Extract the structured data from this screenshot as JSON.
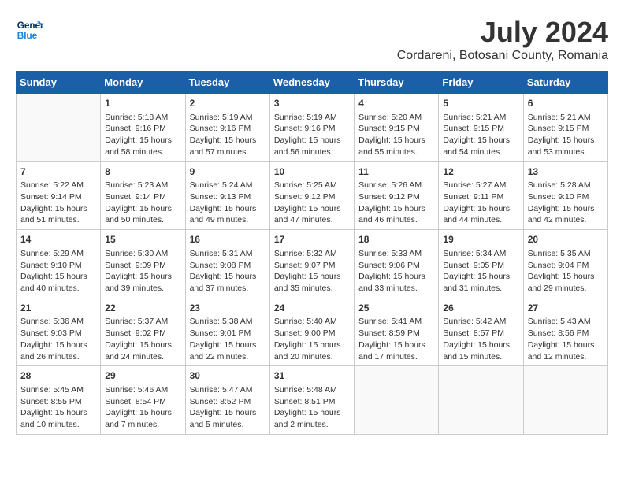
{
  "header": {
    "logo_line1": "General",
    "logo_line2": "Blue",
    "month_year": "July 2024",
    "location": "Cordareni, Botosani County, Romania"
  },
  "weekdays": [
    "Sunday",
    "Monday",
    "Tuesday",
    "Wednesday",
    "Thursday",
    "Friday",
    "Saturday"
  ],
  "weeks": [
    [
      {
        "day": "",
        "data": ""
      },
      {
        "day": "1",
        "data": "Sunrise: 5:18 AM\nSunset: 9:16 PM\nDaylight: 15 hours\nand 58 minutes."
      },
      {
        "day": "2",
        "data": "Sunrise: 5:19 AM\nSunset: 9:16 PM\nDaylight: 15 hours\nand 57 minutes."
      },
      {
        "day": "3",
        "data": "Sunrise: 5:19 AM\nSunset: 9:16 PM\nDaylight: 15 hours\nand 56 minutes."
      },
      {
        "day": "4",
        "data": "Sunrise: 5:20 AM\nSunset: 9:15 PM\nDaylight: 15 hours\nand 55 minutes."
      },
      {
        "day": "5",
        "data": "Sunrise: 5:21 AM\nSunset: 9:15 PM\nDaylight: 15 hours\nand 54 minutes."
      },
      {
        "day": "6",
        "data": "Sunrise: 5:21 AM\nSunset: 9:15 PM\nDaylight: 15 hours\nand 53 minutes."
      }
    ],
    [
      {
        "day": "7",
        "data": "Sunrise: 5:22 AM\nSunset: 9:14 PM\nDaylight: 15 hours\nand 51 minutes."
      },
      {
        "day": "8",
        "data": "Sunrise: 5:23 AM\nSunset: 9:14 PM\nDaylight: 15 hours\nand 50 minutes."
      },
      {
        "day": "9",
        "data": "Sunrise: 5:24 AM\nSunset: 9:13 PM\nDaylight: 15 hours\nand 49 minutes."
      },
      {
        "day": "10",
        "data": "Sunrise: 5:25 AM\nSunset: 9:12 PM\nDaylight: 15 hours\nand 47 minutes."
      },
      {
        "day": "11",
        "data": "Sunrise: 5:26 AM\nSunset: 9:12 PM\nDaylight: 15 hours\nand 46 minutes."
      },
      {
        "day": "12",
        "data": "Sunrise: 5:27 AM\nSunset: 9:11 PM\nDaylight: 15 hours\nand 44 minutes."
      },
      {
        "day": "13",
        "data": "Sunrise: 5:28 AM\nSunset: 9:10 PM\nDaylight: 15 hours\nand 42 minutes."
      }
    ],
    [
      {
        "day": "14",
        "data": "Sunrise: 5:29 AM\nSunset: 9:10 PM\nDaylight: 15 hours\nand 40 minutes."
      },
      {
        "day": "15",
        "data": "Sunrise: 5:30 AM\nSunset: 9:09 PM\nDaylight: 15 hours\nand 39 minutes."
      },
      {
        "day": "16",
        "data": "Sunrise: 5:31 AM\nSunset: 9:08 PM\nDaylight: 15 hours\nand 37 minutes."
      },
      {
        "day": "17",
        "data": "Sunrise: 5:32 AM\nSunset: 9:07 PM\nDaylight: 15 hours\nand 35 minutes."
      },
      {
        "day": "18",
        "data": "Sunrise: 5:33 AM\nSunset: 9:06 PM\nDaylight: 15 hours\nand 33 minutes."
      },
      {
        "day": "19",
        "data": "Sunrise: 5:34 AM\nSunset: 9:05 PM\nDaylight: 15 hours\nand 31 minutes."
      },
      {
        "day": "20",
        "data": "Sunrise: 5:35 AM\nSunset: 9:04 PM\nDaylight: 15 hours\nand 29 minutes."
      }
    ],
    [
      {
        "day": "21",
        "data": "Sunrise: 5:36 AM\nSunset: 9:03 PM\nDaylight: 15 hours\nand 26 minutes."
      },
      {
        "day": "22",
        "data": "Sunrise: 5:37 AM\nSunset: 9:02 PM\nDaylight: 15 hours\nand 24 minutes."
      },
      {
        "day": "23",
        "data": "Sunrise: 5:38 AM\nSunset: 9:01 PM\nDaylight: 15 hours\nand 22 minutes."
      },
      {
        "day": "24",
        "data": "Sunrise: 5:40 AM\nSunset: 9:00 PM\nDaylight: 15 hours\nand 20 minutes."
      },
      {
        "day": "25",
        "data": "Sunrise: 5:41 AM\nSunset: 8:59 PM\nDaylight: 15 hours\nand 17 minutes."
      },
      {
        "day": "26",
        "data": "Sunrise: 5:42 AM\nSunset: 8:57 PM\nDaylight: 15 hours\nand 15 minutes."
      },
      {
        "day": "27",
        "data": "Sunrise: 5:43 AM\nSunset: 8:56 PM\nDaylight: 15 hours\nand 12 minutes."
      }
    ],
    [
      {
        "day": "28",
        "data": "Sunrise: 5:45 AM\nSunset: 8:55 PM\nDaylight: 15 hours\nand 10 minutes."
      },
      {
        "day": "29",
        "data": "Sunrise: 5:46 AM\nSunset: 8:54 PM\nDaylight: 15 hours\nand 7 minutes."
      },
      {
        "day": "30",
        "data": "Sunrise: 5:47 AM\nSunset: 8:52 PM\nDaylight: 15 hours\nand 5 minutes."
      },
      {
        "day": "31",
        "data": "Sunrise: 5:48 AM\nSunset: 8:51 PM\nDaylight: 15 hours\nand 2 minutes."
      },
      {
        "day": "",
        "data": ""
      },
      {
        "day": "",
        "data": ""
      },
      {
        "day": "",
        "data": ""
      }
    ]
  ]
}
